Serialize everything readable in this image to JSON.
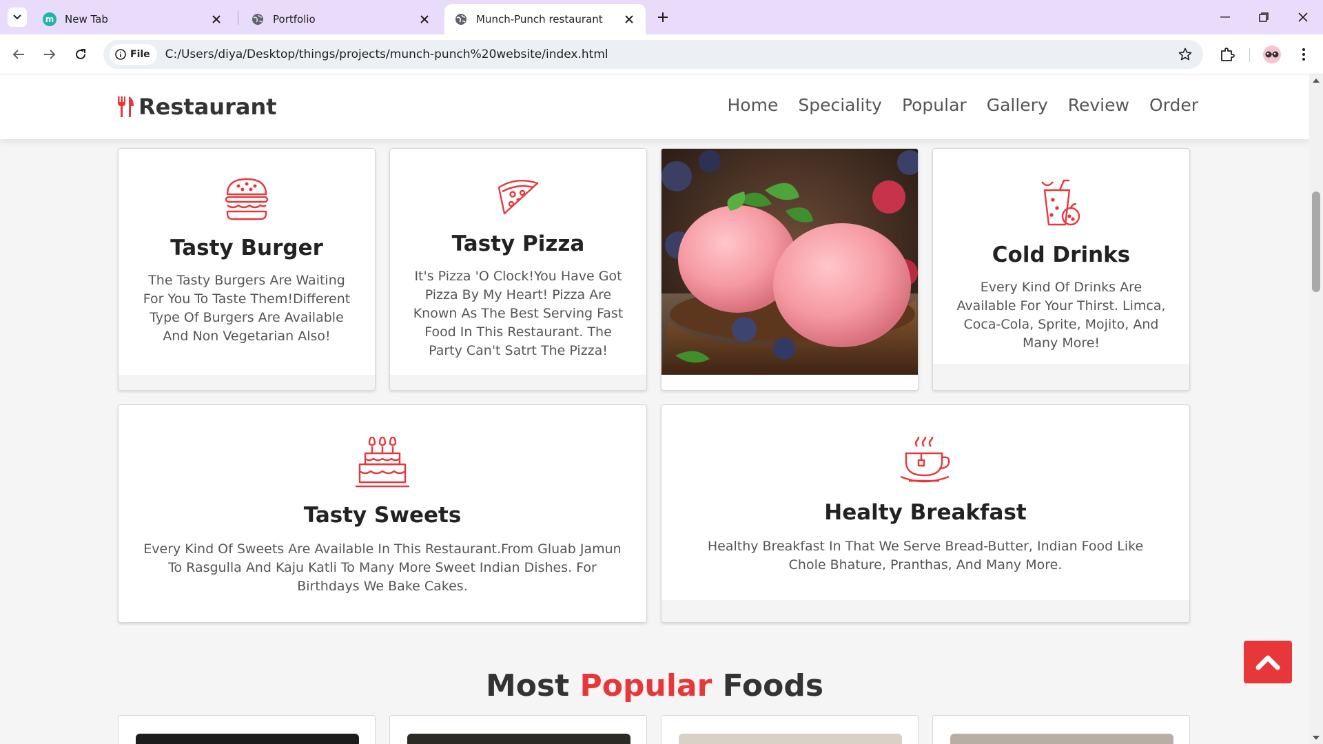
{
  "browser": {
    "tabs": [
      {
        "title": "New Tab",
        "favicon_letter": "m",
        "favicon_color": "#1db5a7"
      },
      {
        "title": "Portfolio"
      },
      {
        "title": "Munch-Punch restaurant"
      }
    ],
    "chip_label": "File",
    "url": "C:/Users/diya/Desktop/things/projects/munch-punch%20website/index.html"
  },
  "site": {
    "logo_text": "Restaurant",
    "nav": [
      "Home",
      "Speciality",
      "Popular",
      "Gallery",
      "Review",
      "Order"
    ],
    "accent_color": "#e8373a"
  },
  "speciality": [
    {
      "icon": "burger-icon",
      "title": "Tasty Burger",
      "text": "The Tasty Burgers Are Waiting For You To Taste Them!Different Type Of Burgers Are Available And Non Vegetarian Also!"
    },
    {
      "icon": "pizza-icon",
      "title": "Tasty Pizza",
      "text": "It's Pizza 'O Clock!You Have Got Pizza By My Heart! Pizza Are Known As The Best Serving Fast Food In This Restaurant. The Party Can't Satrt The Pizza!"
    },
    {
      "icon": "ice-cream-image",
      "title": "",
      "text": ""
    },
    {
      "icon": "drink-icon",
      "title": "Cold Drinks",
      "text": "Every Kind Of Drinks Are Available For Your Thirst. Limca, Coca-Cola, Sprite, Mojito, And Many More!"
    },
    {
      "icon": "cake-icon",
      "title": "Tasty Sweets",
      "text": "Every Kind Of Sweets Are Available In This Restaurant.From Gluab Jamun To Rasgulla And Kaju Katli To Many More Sweet Indian Dishes. For Birthdays We Bake Cakes."
    },
    {
      "icon": "coffee-icon",
      "title": "Healty Breakfast",
      "text": "Healthy Breakfast In That We Serve Bread-Butter, Indian Food Like Chole Bhature, Pranthas, And Many More."
    }
  ],
  "popular": {
    "title_part1": "Most",
    "title_accent": "Popular",
    "title_part2": "Foods"
  }
}
